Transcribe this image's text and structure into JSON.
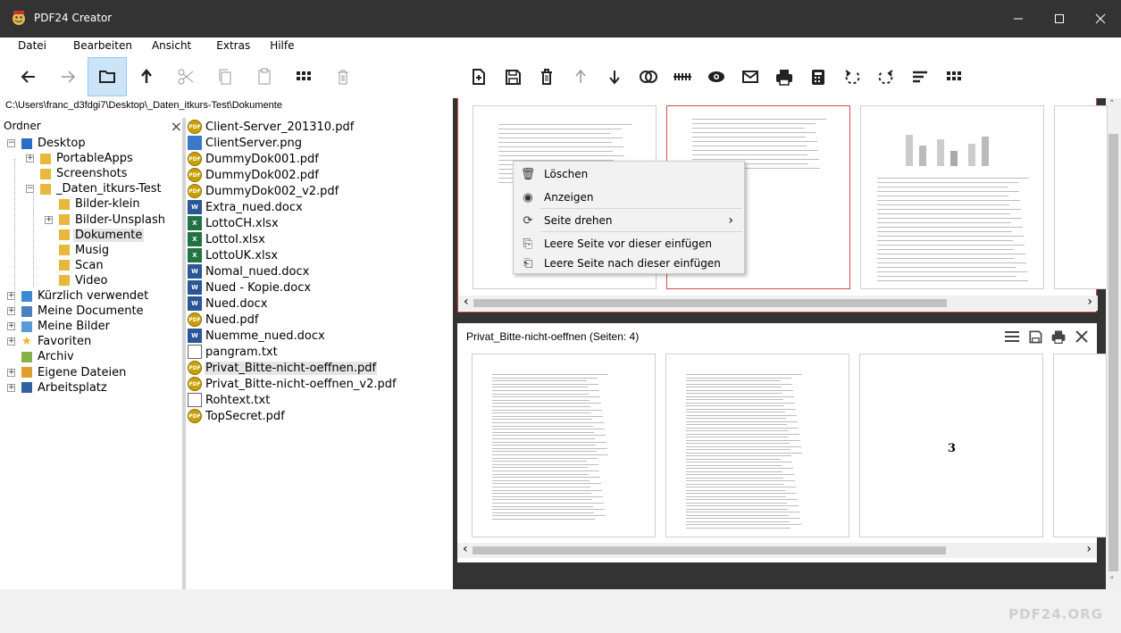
{
  "window": {
    "title": "PDF24 Creator"
  },
  "menu": [
    "Datei",
    "Bearbeiten",
    "Ansicht",
    "Extras",
    "Hilfe"
  ],
  "path": "C:\\Users\\franc_d3fdgi7\\Desktop\\_Daten_itkurs-Test\\Dokumente",
  "folder_panel": {
    "header": "Ordner",
    "close": "×"
  },
  "tree": [
    {
      "label": "Desktop",
      "icon": "desktop-icon"
    },
    {
      "label": "PortableApps",
      "icon": "folder-icon"
    },
    {
      "label": "Screenshots",
      "icon": "folder-icon"
    },
    {
      "label": "_Daten_itkurs-Test",
      "icon": "folder-icon"
    },
    {
      "label": "Bilder-klein",
      "icon": "folder-icon"
    },
    {
      "label": "Bilder-Unsplash",
      "icon": "folder-icon"
    },
    {
      "label": "Dokumente",
      "icon": "folder-icon",
      "selected": true
    },
    {
      "label": "Musig",
      "icon": "folder-icon"
    },
    {
      "label": "Scan",
      "icon": "folder-icon"
    },
    {
      "label": "Video",
      "icon": "folder-icon"
    },
    {
      "label": "Kürzlich verwendet",
      "icon": "recent-icon"
    },
    {
      "label": "Meine Documente",
      "icon": "documents-icon"
    },
    {
      "label": "Meine Bilder",
      "icon": "pictures-icon"
    },
    {
      "label": "Favoriten",
      "icon": "star-icon"
    },
    {
      "label": "Archiv",
      "icon": "archive-icon"
    },
    {
      "label": "Eigene Dateien",
      "icon": "user-folder-icon"
    },
    {
      "label": "Arbeitsplatz",
      "icon": "computer-icon"
    }
  ],
  "files": [
    {
      "name": "Client-Server_201310.pdf",
      "type": "pdf"
    },
    {
      "name": "ClientServer.png",
      "type": "png"
    },
    {
      "name": "DummyDok001.pdf",
      "type": "pdf"
    },
    {
      "name": "DummyDok002.pdf",
      "type": "pdf"
    },
    {
      "name": "DummyDok002_v2.pdf",
      "type": "pdf"
    },
    {
      "name": "Extra_nued.docx",
      "type": "doc"
    },
    {
      "name": "LottoCH.xlsx",
      "type": "xls"
    },
    {
      "name": "LottoI.xlsx",
      "type": "xls"
    },
    {
      "name": "LottoUK.xlsx",
      "type": "xls"
    },
    {
      "name": "Nomal_nued.docx",
      "type": "doc"
    },
    {
      "name": "Nued - Kopie.docx",
      "type": "doc"
    },
    {
      "name": "Nued.docx",
      "type": "doc"
    },
    {
      "name": "Nued.pdf",
      "type": "pdf"
    },
    {
      "name": "Nuemme_nued.docx",
      "type": "doc"
    },
    {
      "name": "pangram.txt",
      "type": "txt"
    },
    {
      "name": "Privat_Bitte-nicht-oeffnen.pdf",
      "type": "pdf",
      "selected": true
    },
    {
      "name": "Privat_Bitte-nicht-oeffnen_v2.pdf",
      "type": "pdf"
    },
    {
      "name": "Rohtext.txt",
      "type": "txt"
    },
    {
      "name": "TopSecret.pdf",
      "type": "pdf"
    }
  ],
  "icon_labels": {
    "pdf": "PDF",
    "doc": "W",
    "xls": "X",
    "png": "",
    "txt": ""
  },
  "context_menu": [
    {
      "label": "Löschen",
      "icon": "trash-icon"
    },
    {
      "label": "Anzeigen",
      "icon": "eye-icon"
    },
    {
      "label": "Seite drehen",
      "icon": "rotate-icon",
      "submenu": "›"
    },
    {
      "label": "Leere Seite vor dieser einfügen",
      "icon": "insert-before-icon"
    },
    {
      "label": "Leere Seite nach dieser einfügen",
      "icon": "insert-after-icon"
    }
  ],
  "doc2": {
    "title": "Privat_Bitte-nicht-oeffnen (Seiten: 4)",
    "page3_number": "3"
  },
  "scroll": {
    "left": "‹",
    "right": "›",
    "up": "˄",
    "down": "˅"
  },
  "footer": {
    "brand": "PDF24.ORG"
  },
  "colors": {
    "titlebar": "#333333",
    "accent_red": "#d24b4b",
    "selection": "#cce4f7"
  }
}
